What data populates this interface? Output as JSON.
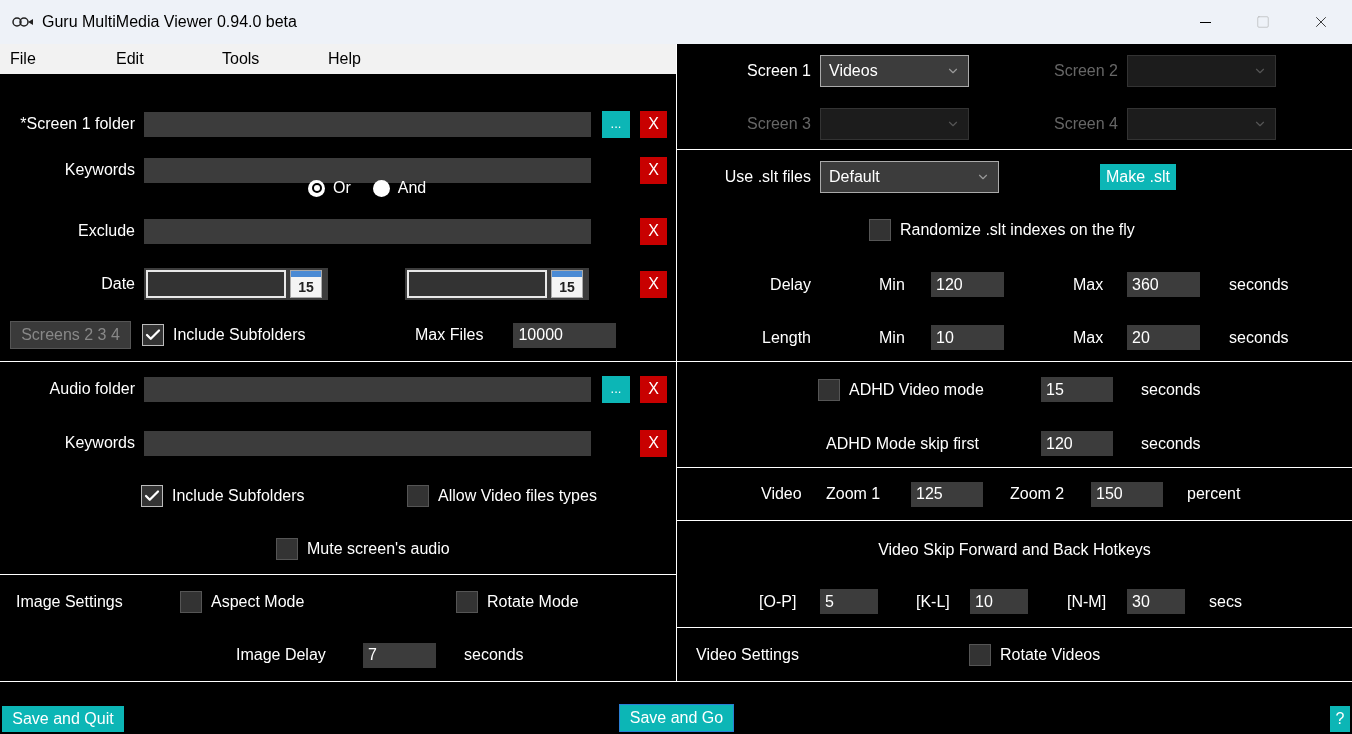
{
  "window": {
    "title": "Guru MultiMedia Viewer 0.94.0 beta"
  },
  "menu": [
    "File",
    "Edit",
    "Tools",
    "Help"
  ],
  "screen_folder": {
    "label": "*Screen 1 folder",
    "browse": "...",
    "clear": "X"
  },
  "keywords": {
    "label": "Keywords",
    "clear": "X"
  },
  "match_mode": [
    {
      "label": "Or",
      "selected": true
    },
    {
      "label": "And",
      "selected": false
    }
  ],
  "exclude": {
    "label": "Exclude",
    "clear": "X"
  },
  "date": {
    "label": "Date",
    "calendar_day": [
      "15",
      "15"
    ],
    "clear": "X"
  },
  "screens_button": {
    "label": "Screens 2 3 4",
    "disabled": true
  },
  "include_subfolders": {
    "label": "Include Subfolders",
    "checked": true
  },
  "max_files": {
    "label": "Max Files",
    "value": "10000"
  },
  "audio_folder": {
    "label": "Audio folder",
    "browse": "...",
    "clear": "X"
  },
  "audio_keywords": {
    "label": "Keywords",
    "clear": "X"
  },
  "audio_include_subfolders": {
    "label": "Include Subfolders",
    "checked": true
  },
  "allow_video_types": {
    "label": "Allow Video files types",
    "checked": false
  },
  "mute_audio": {
    "label": "Mute screen's audio",
    "checked": false
  },
  "image_settings": {
    "label": "Image Settings",
    "aspect_mode": {
      "label": "Aspect Mode",
      "checked": false
    },
    "rotate_mode": {
      "label": "Rotate Mode",
      "checked": false
    },
    "delay": {
      "label": "Image Delay",
      "value": "7",
      "unit": "seconds"
    }
  },
  "screens": [
    {
      "label": "Screen 1",
      "value": "Videos",
      "disabled": false
    },
    {
      "label": "Screen 2",
      "disabled": true
    },
    {
      "label": "Screen 3",
      "disabled": true
    },
    {
      "label": "Screen 4",
      "disabled": true
    }
  ],
  "slt": {
    "label": "Use .slt files",
    "value": "Default",
    "make_button": "Make .slt",
    "randomize": {
      "label": "Randomize .slt indexes on the fly",
      "checked": false
    }
  },
  "timing": [
    {
      "label": "Delay",
      "min_label": "Min",
      "min": "120",
      "max_label": "Max",
      "max": "360",
      "unit": "seconds"
    },
    {
      "label": "Length",
      "min_label": "Min",
      "min": "10",
      "max_label": "Max",
      "max": "20",
      "unit": "seconds"
    }
  ],
  "adhd": {
    "mode": {
      "label": "ADHD Video mode",
      "checked": false,
      "value": "15",
      "unit": "seconds"
    },
    "skip_first": {
      "label": "ADHD Mode skip first",
      "value": "120",
      "unit": "seconds"
    }
  },
  "video_zoom": {
    "label": "Video",
    "zoom1_label": "Zoom 1",
    "zoom1": "125",
    "zoom2_label": "Zoom 2",
    "zoom2": "150",
    "unit": "percent"
  },
  "hotkeys": {
    "title": "Video Skip Forward and Back Hotkeys",
    "items": [
      {
        "keys": "[O-P]",
        "value": "5"
      },
      {
        "keys": "[K-L]",
        "value": "10"
      },
      {
        "keys": "[N-M]",
        "value": "30"
      }
    ],
    "unit": "secs"
  },
  "video_settings": {
    "label": "Video Settings",
    "rotate": {
      "label": "Rotate Videos",
      "checked": false
    }
  },
  "footer": {
    "save_quit": "Save and Quit",
    "save_go": "Save and Go",
    "help": "?"
  }
}
